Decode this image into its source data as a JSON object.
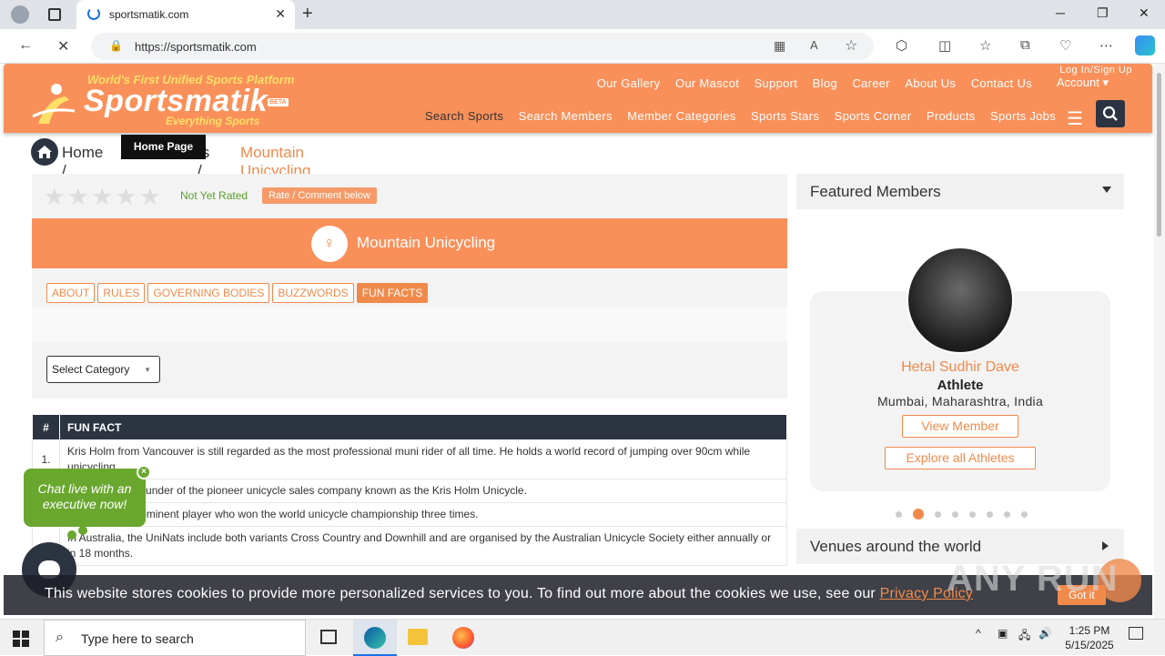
{
  "browser": {
    "tab_title": "sportsmatik.com",
    "url": "https://sportsmatik.com"
  },
  "site": {
    "logo_tagline": "World's First Unified Sports Platform",
    "logo_name": "Sportsmatik",
    "logo_beta": "BETA",
    "logo_sub": "Everything Sports",
    "top_nav": [
      "Our Gallery",
      "Our Mascot",
      "Support",
      "Blog",
      "Career",
      "About Us",
      "Contact Us"
    ],
    "login": "Log In/Sign Up",
    "account": "Account ▾",
    "bottom_nav": [
      "Search Sports",
      "Search Members",
      "Member Categories",
      "Sports Stars",
      "Sports Corner",
      "Products",
      "Sports Jobs"
    ]
  },
  "breadcrumb": {
    "home": "Home /",
    "middle": "ts  /",
    "current": "Mountain Unicycling",
    "tooltip": "Home Page"
  },
  "rating": {
    "status": "Not Yet Rated",
    "rate_button": "Rate / Comment below"
  },
  "sport_title": "Mountain Unicycling",
  "tabs": [
    "ABOUT",
    "RULES",
    "GOVERNING BODIES",
    "BUZZWORDS",
    "FUN FACTS"
  ],
  "category_select": "Select Category",
  "table": {
    "col_num": "#",
    "col_fact": "FUN FACT",
    "rows": [
      {
        "num": "1.",
        "text": "Kris Holm from Vancouver is still regarded as the most professional muni rider of all time. He holds a world record of jumping over 90cm while unicycling."
      },
      {
        "num": "",
        "text": "He is also the founder of the pioneer unicycle sales company known as the Kris Holm Unicycle."
      },
      {
        "num": "",
        "text": "... is another prominent player who won the world unicycle championship three times."
      },
      {
        "num": "",
        "text": "In Australia, the UniNats include both variants Cross Country and Downhill and are organised by the Australian Unicycle Society either annually or in 18 months."
      }
    ]
  },
  "chat": {
    "message": "Chat live with an executive now!",
    "close": "×"
  },
  "sidebar": {
    "featured_title": "Featured Members",
    "member_name": "Hetal Sudhir Dave",
    "member_role": "Athlete",
    "member_location": "Mumbai, Maharashtra, India",
    "view_button": "View Member",
    "explore_button": "Explore all Athletes",
    "carousel_active": 2,
    "carousel_count": 8,
    "venues_title": "Venues around the world"
  },
  "cookie": {
    "message": "This website stores cookies to provide more personalized services to you. To find out more about the cookies we use, see our",
    "link": "Privacy Policy",
    "button": "Got it"
  },
  "watermark": "ANY RUN",
  "taskbar": {
    "search_placeholder": "Type here to search",
    "time": "1:25 PM",
    "date": "5/15/2025"
  },
  "colors": {
    "brand_orange": "#f9905a",
    "dark_navy": "#2d3441",
    "chat_green": "#6aa72e"
  }
}
